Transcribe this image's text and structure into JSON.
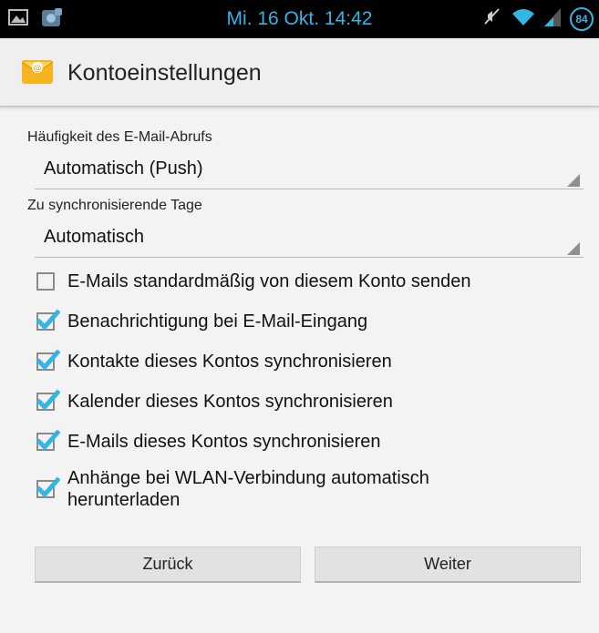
{
  "status_bar": {
    "time": "Mi. 16 Okt. 14:42",
    "battery_level": "84",
    "icons": [
      "image-icon",
      "app-notification-icon",
      "mute-icon",
      "wifi-icon",
      "signal-icon",
      "battery-icon"
    ],
    "accent_color": "#33b5e5"
  },
  "action_bar": {
    "title": "Kontoeinstellungen",
    "icon": "email-app-icon"
  },
  "settings": {
    "fetch_frequency": {
      "label": "Häufigkeit des E-Mail-Abrufs",
      "value": "Automatisch (Push)"
    },
    "sync_days": {
      "label": "Zu synchronisierende Tage",
      "value": "Automatisch"
    }
  },
  "options": [
    {
      "label": "E-Mails standardmäßig von diesem Konto senden",
      "checked": false
    },
    {
      "label": "Benachrichtigung bei E-Mail-Eingang",
      "checked": true
    },
    {
      "label": "Kontakte dieses Kontos synchronisieren",
      "checked": true
    },
    {
      "label": "Kalender dieses Kontos synchronisieren",
      "checked": true
    },
    {
      "label": "E-Mails dieses Kontos synchronisieren",
      "checked": true
    },
    {
      "label": "Anhänge bei WLAN-Verbindung automatisch herunterladen",
      "checked": true
    }
  ],
  "buttons": {
    "back": "Zurück",
    "next": "Weiter"
  },
  "check_color": "#33b5e5"
}
